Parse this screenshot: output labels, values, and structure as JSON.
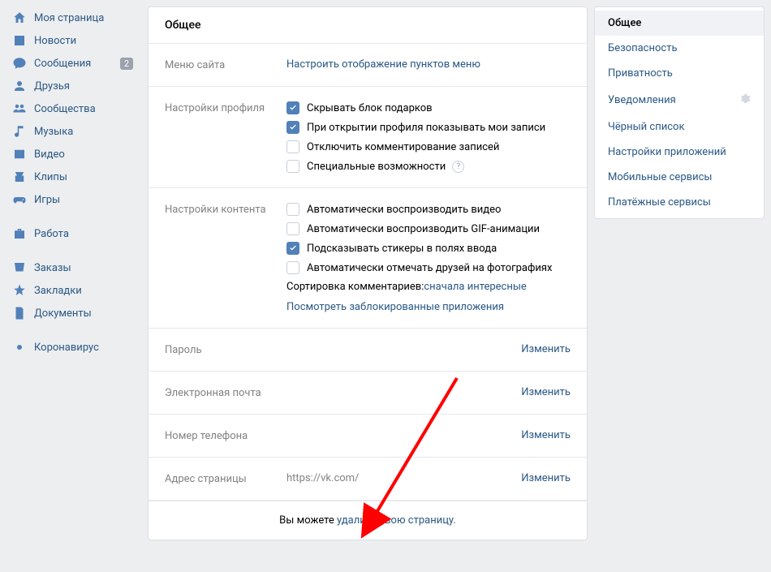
{
  "leftnav": {
    "items": [
      {
        "label": "Моя страница",
        "icon": "home"
      },
      {
        "label": "Новости",
        "icon": "news"
      },
      {
        "label": "Сообщения",
        "icon": "messages",
        "badge": "2"
      },
      {
        "label": "Друзья",
        "icon": "friend"
      },
      {
        "label": "Сообщества",
        "icon": "community"
      },
      {
        "label": "Музыка",
        "icon": "music"
      },
      {
        "label": "Видео",
        "icon": "video"
      },
      {
        "label": "Клипы",
        "icon": "clips"
      },
      {
        "label": "Игры",
        "icon": "games"
      }
    ],
    "items2": [
      {
        "label": "Работа",
        "icon": "work"
      }
    ],
    "items3": [
      {
        "label": "Заказы",
        "icon": "orders"
      },
      {
        "label": "Закладки",
        "icon": "bookmarks"
      },
      {
        "label": "Документы",
        "icon": "docs"
      }
    ],
    "items4": [
      {
        "label": "Коронавирус",
        "icon": "covid"
      }
    ]
  },
  "main": {
    "title": "Общее",
    "section_menu": {
      "label": "Меню сайта",
      "link": "Настроить отображение пунктов меню"
    },
    "section_profile": {
      "label": "Настройки профиля",
      "opts": [
        {
          "label": "Скрывать блок подарков",
          "checked": true
        },
        {
          "label": "При открытии профиля показывать мои записи",
          "checked": true
        },
        {
          "label": "Отключить комментирование записей",
          "checked": false
        },
        {
          "label": "Специальные возможности",
          "checked": false,
          "help": true
        }
      ]
    },
    "section_content": {
      "label": "Настройки контента",
      "opts": [
        {
          "label": "Автоматически воспроизводить видео",
          "checked": false
        },
        {
          "label": "Автоматически воспроизводить GIF-анимации",
          "checked": false
        },
        {
          "label": "Подсказывать стикеры в полях ввода",
          "checked": true
        },
        {
          "label": "Автоматически отмечать друзей на фотографиях",
          "checked": false
        }
      ],
      "sort_prefix": "Сортировка комментариев: ",
      "sort_link": "сначала интересные",
      "blocked_link": "Посмотреть заблокированные приложения"
    },
    "section_password": {
      "label": "Пароль",
      "action": "Изменить"
    },
    "section_email": {
      "label": "Электронная почта",
      "action": "Изменить"
    },
    "section_phone": {
      "label": "Номер телефона",
      "action": "Изменить"
    },
    "section_address": {
      "label": "Адрес страницы",
      "value": "https://vk.com/",
      "action": "Изменить"
    },
    "footer_prefix": "Вы можете ",
    "footer_link": "удалить свою страницу."
  },
  "rightnav": {
    "items": [
      {
        "label": "Общее",
        "active": true
      },
      {
        "label": "Безопасность"
      },
      {
        "label": "Приватность"
      },
      {
        "label": "Уведомления",
        "gear": true
      },
      {
        "label": "Чёрный список"
      },
      {
        "label": "Настройки приложений"
      },
      {
        "label": "Мобильные сервисы"
      },
      {
        "label": "Платёжные сервисы"
      }
    ]
  }
}
